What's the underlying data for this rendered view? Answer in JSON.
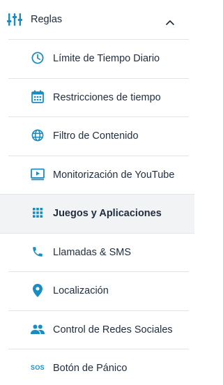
{
  "colors": {
    "accent": "#1a8cc0",
    "text": "#1f2d3d",
    "active_bg": "#f2f3f5",
    "divider": "#e1e4e8"
  },
  "header": {
    "label": "Reglas",
    "icon": "sliders-icon",
    "chevron": "chevron-up-icon"
  },
  "items": [
    {
      "label": "Límite de Tiempo Diario",
      "icon": "clock-icon",
      "active": false
    },
    {
      "label": "Restricciones de tiempo",
      "icon": "calendar-icon",
      "active": false
    },
    {
      "label": "Filtro de Contenido",
      "icon": "globe-icon",
      "active": false
    },
    {
      "label": "Monitorización de YouTube",
      "icon": "youtube-icon",
      "active": false
    },
    {
      "label": "Juegos y Aplicaciones",
      "icon": "apps-grid-icon",
      "active": true
    },
    {
      "label": "Llamadas & SMS",
      "icon": "phone-icon",
      "active": false
    },
    {
      "label": "Localización",
      "icon": "location-pin-icon",
      "active": false
    },
    {
      "label": "Control de Redes Sociales",
      "icon": "people-icon",
      "active": false
    },
    {
      "label": "Botón de Pánico",
      "icon": "sos-icon",
      "icon_text": "SOS",
      "active": false
    }
  ]
}
